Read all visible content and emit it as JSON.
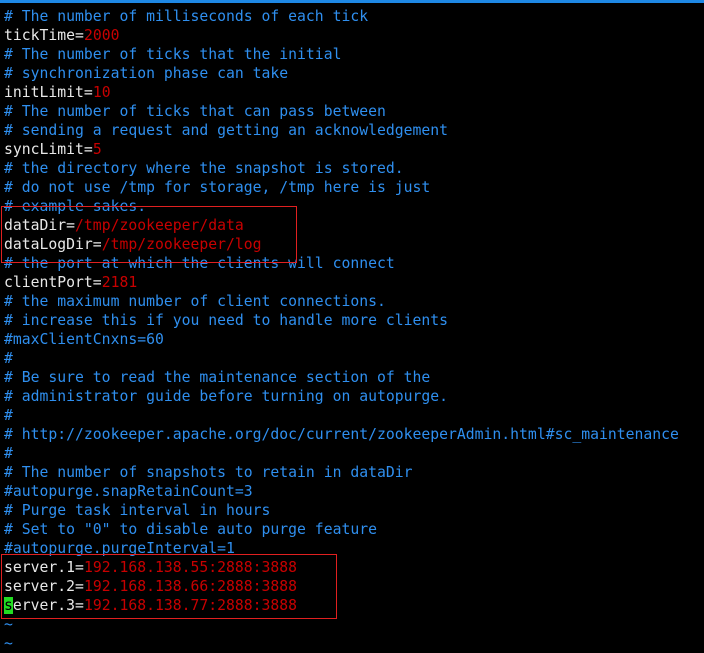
{
  "colors": {
    "comment": "#2f8fef",
    "value": "#c80000",
    "key": "#e8e8e8",
    "cursor": "#22dd22",
    "highlight_box": "#e02020"
  },
  "lines": [
    {
      "comment": "# The number of milliseconds of each tick"
    },
    {
      "key": "tickTime=",
      "value": "2000"
    },
    {
      "comment": "# The number of ticks that the initial"
    },
    {
      "comment": "# synchronization phase can take"
    },
    {
      "key": "initLimit=",
      "value": "10"
    },
    {
      "comment": "# The number of ticks that can pass between"
    },
    {
      "comment": "# sending a request and getting an acknowledgement"
    },
    {
      "key": "syncLimit=",
      "value": "5"
    },
    {
      "comment": "# the directory where the snapshot is stored."
    },
    {
      "comment": "# do not use /tmp for storage, /tmp here is just"
    },
    {
      "comment": "# example sakes."
    },
    {
      "key": "dataDir=",
      "value": "/tmp/zookeeper/data"
    },
    {
      "key": "dataLogDir=",
      "value": "/tmp/zookeeper/log"
    },
    {
      "comment": "# the port at which the clients will connect"
    },
    {
      "key": "clientPort=",
      "value": "2181"
    },
    {
      "comment": "# the maximum number of client connections."
    },
    {
      "comment": "# increase this if you need to handle more clients"
    },
    {
      "comment": "#maxClientCnxns=60"
    },
    {
      "comment": "#"
    },
    {
      "comment": "# Be sure to read the maintenance section of the"
    },
    {
      "comment": "# administrator guide before turning on autopurge."
    },
    {
      "comment": "#"
    },
    {
      "comment": "# http://zookeeper.apache.org/doc/current/zookeeperAdmin.html#sc_maintenance"
    },
    {
      "comment": "#"
    },
    {
      "comment": "# The number of snapshots to retain in dataDir"
    },
    {
      "comment": "#autopurge.snapRetainCount=3"
    },
    {
      "comment": "# Purge task interval in hours"
    },
    {
      "comment": "# Set to \"0\" to disable auto purge feature"
    },
    {
      "comment": "#autopurge.purgeInterval=1"
    },
    {
      "key": "server.1=",
      "value": "192.168.138.55:2888:3888"
    },
    {
      "key": "server.2=",
      "value": "192.168.138.66:2888:3888"
    },
    {
      "key": "server.3=",
      "value": "192.168.138.77:2888:3888",
      "cursor": true
    },
    {
      "tilde": "~"
    },
    {
      "tilde": "~"
    }
  ]
}
